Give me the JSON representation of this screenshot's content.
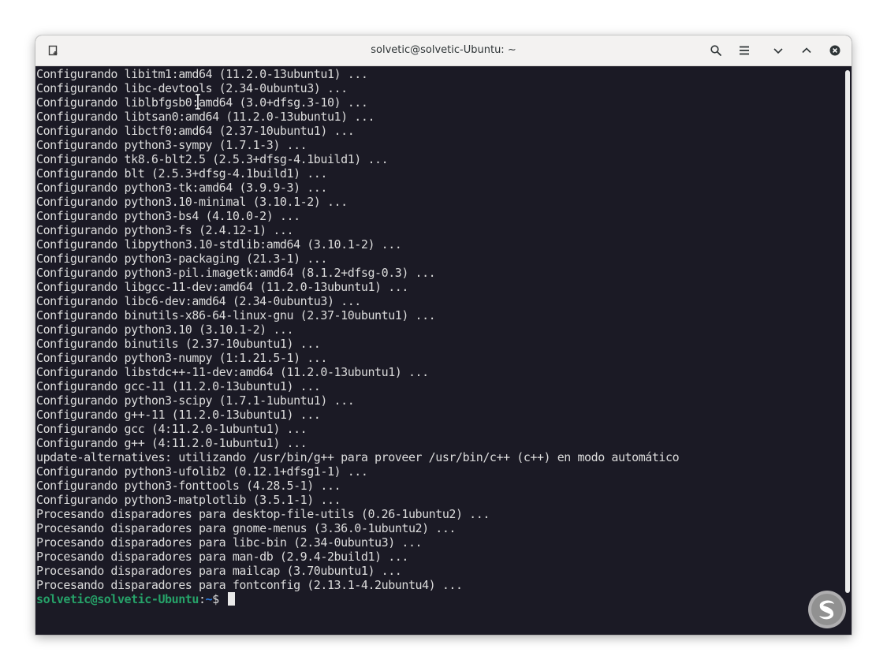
{
  "window": {
    "title": "solvetic@solvetic-Ubuntu: ~",
    "icons": {
      "new_tab": "new-tab-icon",
      "search": "search-icon",
      "menu": "hamburger-menu-icon",
      "minimize": "chevron-down-icon",
      "maximize": "chevron-up-icon",
      "close": "close-icon"
    }
  },
  "terminal": {
    "lines": [
      "Configurando libitm1:amd64 (11.2.0-13ubuntu1) ...",
      "Configurando libc-devtools (2.34-0ubuntu3) ...",
      "Configurando liblbfgsb0:amd64 (3.0+dfsg.3-10) ...",
      "Configurando libtsan0:amd64 (11.2.0-13ubuntu1) ...",
      "Configurando libctf0:amd64 (2.37-10ubuntu1) ...",
      "Configurando python3-sympy (1.7.1-3) ...",
      "Configurando tk8.6-blt2.5 (2.5.3+dfsg-4.1build1) ...",
      "Configurando blt (2.5.3+dfsg-4.1build1) ...",
      "Configurando python3-tk:amd64 (3.9.9-3) ...",
      "Configurando python3.10-minimal (3.10.1-2) ...",
      "Configurando python3-bs4 (4.10.0-2) ...",
      "Configurando python3-fs (2.4.12-1) ...",
      "Configurando libpython3.10-stdlib:amd64 (3.10.1-2) ...",
      "Configurando python3-packaging (21.3-1) ...",
      "Configurando python3-pil.imagetk:amd64 (8.1.2+dfsg-0.3) ...",
      "Configurando libgcc-11-dev:amd64 (11.2.0-13ubuntu1) ...",
      "Configurando libc6-dev:amd64 (2.34-0ubuntu3) ...",
      "Configurando binutils-x86-64-linux-gnu (2.37-10ubuntu1) ...",
      "Configurando python3.10 (3.10.1-2) ...",
      "Configurando binutils (2.37-10ubuntu1) ...",
      "Configurando python3-numpy (1:1.21.5-1) ...",
      "Configurando libstdc++-11-dev:amd64 (11.2.0-13ubuntu1) ...",
      "Configurando gcc-11 (11.2.0-13ubuntu1) ...",
      "Configurando python3-scipy (1.7.1-1ubuntu1) ...",
      "Configurando g++-11 (11.2.0-13ubuntu1) ...",
      "Configurando gcc (4:11.2.0-1ubuntu1) ...",
      "Configurando g++ (4:11.2.0-1ubuntu1) ...",
      "update-alternatives: utilizando /usr/bin/g++ para proveer /usr/bin/c++ (c++) en modo automático",
      "Configurando python3-ufolib2 (0.12.1+dfsg1-1) ...",
      "Configurando python3-fonttools (4.28.5-1) ...",
      "Configurando python3-matplotlib (3.5.1-1) ...",
      "Procesando disparadores para desktop-file-utils (0.26-1ubuntu2) ...",
      "Procesando disparadores para gnome-menus (3.36.0-1ubuntu2) ...",
      "Procesando disparadores para libc-bin (2.34-0ubuntu3) ...",
      "Procesando disparadores para man-db (2.9.4-2build1) ...",
      "Procesando disparadores para mailcap (3.70ubuntu1) ...",
      "Procesando disparadores para fontconfig (2.13.1-4.2ubuntu4) ..."
    ],
    "prompt": {
      "user_host": "solvetic@solvetic-Ubuntu",
      "separator": ":",
      "path": "~",
      "symbol": "$ "
    }
  },
  "colors": {
    "terminal_bg": "#1b1a25",
    "terminal_fg": "#dcdcdc",
    "prompt_user": "#26a269",
    "prompt_path": "#2a7bde",
    "titlebar_bg": "#f3f2f1"
  },
  "watermark": {
    "icon": "solvetic-logo-icon"
  }
}
